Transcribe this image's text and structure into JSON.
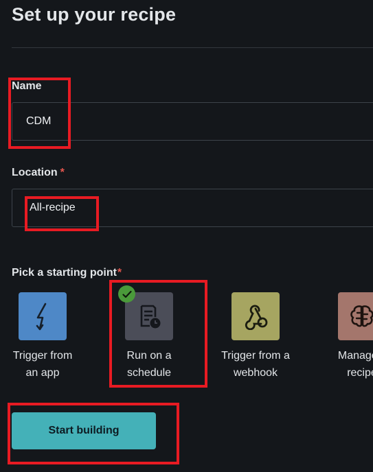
{
  "page": {
    "title": "Set up your recipe"
  },
  "name_field": {
    "label": "Name",
    "value": "CDM"
  },
  "location_field": {
    "label": "Location",
    "required_mark": "*",
    "value": "All-recipe"
  },
  "starting_point": {
    "label": "Pick a starting point",
    "required_mark": "*",
    "selected": "Run on a schedule",
    "options": [
      {
        "line1": "Trigger from",
        "line2": "an app",
        "icon": "lightning-icon",
        "color": "#4e88c7"
      },
      {
        "line1": "Run on a",
        "line2": "schedule",
        "icon": "schedule-icon",
        "color": "#4b4d58"
      },
      {
        "line1": "Trigger from a",
        "line2": "webhook",
        "icon": "webhook-icon",
        "color": "#a6a561"
      },
      {
        "line1": "Manage c",
        "line2": "recipe",
        "icon": "brain-icon",
        "color": "#a4766c"
      }
    ]
  },
  "actions": {
    "start_building": "Start building"
  },
  "colors": {
    "background": "#14171b",
    "accent_button": "#44b1b8",
    "highlight_box": "#e81b23",
    "required": "#e4564e",
    "selected_check": "#4a9a3a"
  }
}
